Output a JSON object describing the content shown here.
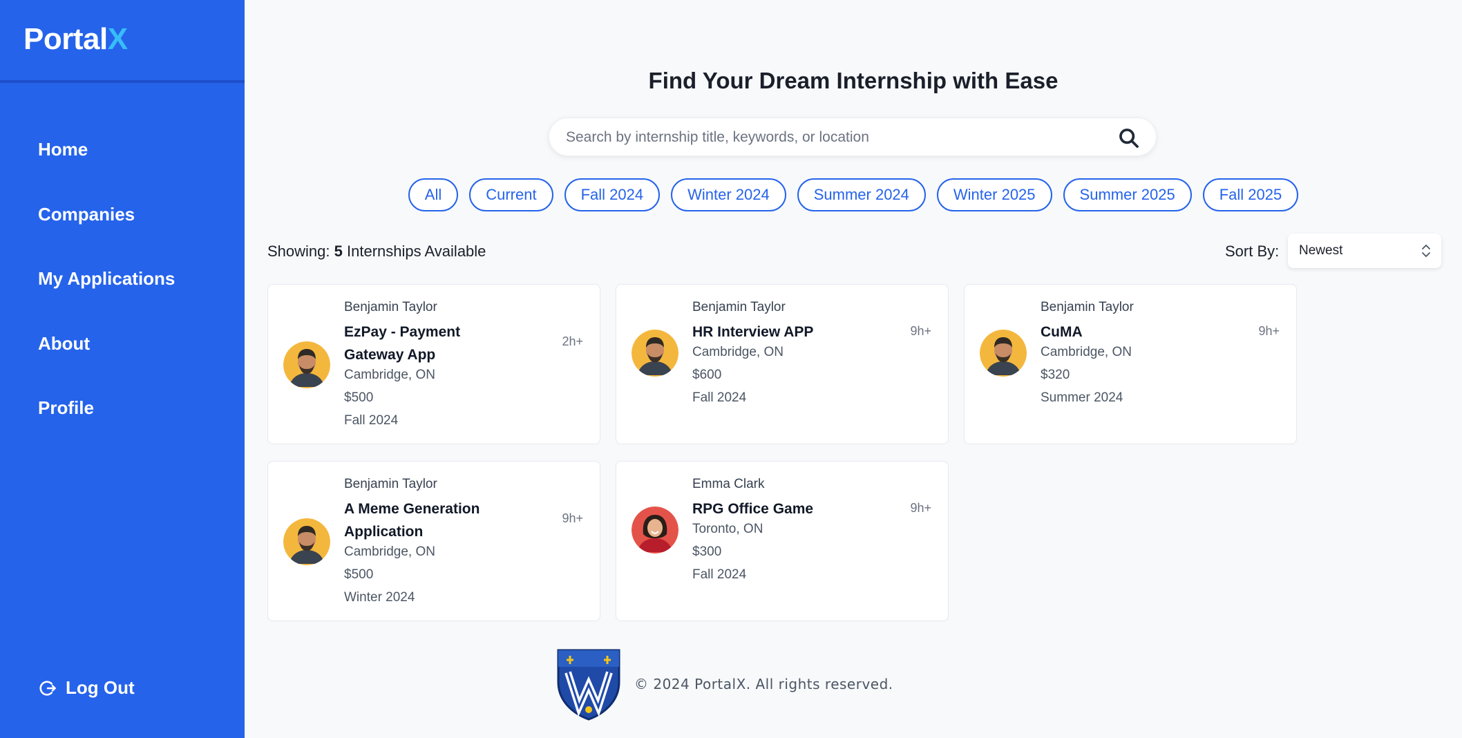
{
  "sidebar": {
    "brand": "Portal",
    "brand_accent": "X",
    "nav": [
      "Home",
      "Companies",
      "My Applications",
      "About",
      "Profile"
    ],
    "logout_label": "Log Out"
  },
  "main": {
    "title": "Find Your Dream Internship with Ease",
    "search_placeholder": "Search by internship title, keywords, or location",
    "filters": [
      "All",
      "Current",
      "Fall 2024",
      "Winter 2024",
      "Summer 2024",
      "Winter 2025",
      "Summer 2025",
      "Fall 2025"
    ],
    "showing_prefix": "Showing:",
    "showing_count": "5",
    "showing_suffix": "Internships Available",
    "sort_label": "Sort By:",
    "sort_value": "Newest"
  },
  "cards": [
    {
      "company": "Benjamin Taylor",
      "title": "EzPay - Payment Gateway App",
      "time": "2h+",
      "location": "Cambridge, ON",
      "pay": "$500",
      "term": "Fall 2024",
      "avatar": "male-avatar"
    },
    {
      "company": "Benjamin Taylor",
      "title": "HR Interview APP",
      "time": "9h+",
      "location": "Cambridge, ON",
      "pay": "$600",
      "term": "Fall 2024",
      "avatar": "male-avatar"
    },
    {
      "company": "Benjamin Taylor",
      "title": "CuMA",
      "time": "9h+",
      "location": "Cambridge, ON",
      "pay": "$320",
      "term": "Summer 2024",
      "avatar": "male-avatar"
    },
    {
      "company": "Benjamin Taylor",
      "title": "A Meme Generation Application",
      "time": "9h+",
      "location": "Cambridge, ON",
      "pay": "$500",
      "term": "Winter 2024",
      "avatar": "male-avatar"
    },
    {
      "company": "Emma Clark",
      "title": "RPG Office Game",
      "time": "9h+",
      "location": "Toronto, ON",
      "pay": "$300",
      "term": "Fall 2024",
      "avatar": "female-avatar"
    }
  ],
  "footer": {
    "text": "© 2024 PortalX. All rights reserved.",
    "logo": "university-shield-logo"
  },
  "colors": {
    "sidebar": "#2563eb",
    "accent": "#38bdf8",
    "chip": "#2563eb",
    "background": "#f7f9fb"
  }
}
